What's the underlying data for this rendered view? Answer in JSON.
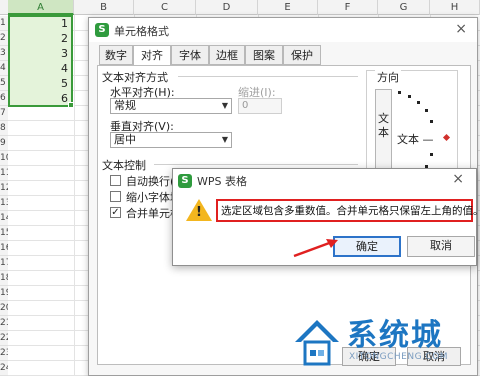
{
  "sheet": {
    "columns": [
      "A",
      "B",
      "C",
      "D",
      "E",
      "F",
      "G",
      "H"
    ],
    "rows": [
      "1",
      "2",
      "3",
      "4",
      "5",
      "6",
      "7",
      "8",
      "9",
      "10",
      "11",
      "12",
      "13",
      "14",
      "15",
      "16",
      "17",
      "18",
      "19",
      "20",
      "21",
      "22",
      "23",
      "24"
    ],
    "cells": [
      "1",
      "2",
      "3",
      "4",
      "5",
      "6"
    ]
  },
  "format_dialog": {
    "logo": "S",
    "title": "单元格格式",
    "close_icon": "×",
    "tabs": [
      "数字",
      "对齐",
      "字体",
      "边框",
      "图案",
      "保护"
    ],
    "active_tab": "对齐",
    "text_alignment_heading": "文本对齐方式",
    "horizontal_label": "水平对齐(H):",
    "horizontal_value": "常规",
    "indent_label": "缩进(I):",
    "indent_value": "0",
    "vertical_label": "垂直对齐(V):",
    "vertical_value": "居中",
    "text_control_heading": "文本控制",
    "wrap_text": "自动换行(",
    "shrink_to_fit": "缩小字体填",
    "merge_cells": "合并单元格",
    "orientation_heading": "方向",
    "vertical_text": "文本",
    "orientation_text": "文本 —",
    "ok_label": "确定",
    "cancel_label": "取消"
  },
  "alert": {
    "logo": "S",
    "title": "WPS 表格",
    "close_icon": "×",
    "warning_glyph": "!",
    "message": "选定区域包含多重数值。合并单元格只保留左上角的值。",
    "ok_label": "确定",
    "cancel_label": "取消"
  },
  "watermark": {
    "brand": "系统城",
    "url": "XITONGCHENG.COM"
  },
  "colors": {
    "selection_green": "#3a9a3a",
    "cell_fill": "#e4f3da",
    "highlight_red": "#e02020",
    "primary_blue": "#2d73c9",
    "brand_blue": "#1d76c2"
  }
}
